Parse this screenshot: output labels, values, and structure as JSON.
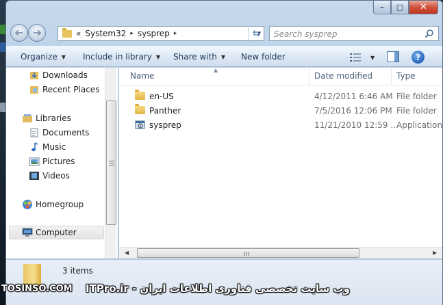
{
  "window": {
    "caption_buttons": {
      "minimize": "–",
      "maximize": "□",
      "close": "✕"
    }
  },
  "nav": {
    "back_icon": "back-arrow-icon",
    "forward_icon": "forward-arrow-icon",
    "address": {
      "prefix": "«",
      "crumbs": [
        "System32",
        "sysprep"
      ],
      "separator": "▸",
      "dropdown": "▾"
    },
    "refresh_glyph": "⇆",
    "search": {
      "placeholder": "Search sysprep",
      "icon": "magnifier-icon"
    }
  },
  "toolbar": {
    "organize": "Organize",
    "include_in_library": "Include in library",
    "share_with": "Share with",
    "new_folder": "New folder",
    "dropdown_arrow": "▼",
    "help": "?"
  },
  "sidebar": {
    "items": [
      {
        "label": "Downloads",
        "icon": "downloads-folder-icon",
        "level": 1
      },
      {
        "label": "Recent Places",
        "icon": "recent-places-icon",
        "level": 1
      },
      {
        "label": "Libraries",
        "icon": "libraries-icon",
        "level": 0
      },
      {
        "label": "Documents",
        "icon": "documents-library-icon",
        "level": 1
      },
      {
        "label": "Music",
        "icon": "music-library-icon",
        "level": 1
      },
      {
        "label": "Pictures",
        "icon": "pictures-library-icon",
        "level": 1
      },
      {
        "label": "Videos",
        "icon": "videos-library-icon",
        "level": 1
      },
      {
        "label": "Homegroup",
        "icon": "homegroup-icon",
        "level": 0
      },
      {
        "label": "Computer",
        "icon": "computer-icon",
        "level": 0,
        "selected": true
      }
    ]
  },
  "file_list": {
    "columns": [
      "Name",
      "Date modified",
      "Type"
    ],
    "sort_indicator": "▲",
    "rows": [
      {
        "name": "en-US",
        "date": "4/12/2011 6:46 AM",
        "type": "File folder",
        "icon": "folder-icon"
      },
      {
        "name": "Panther",
        "date": "7/5/2016 12:06 PM",
        "type": "File folder",
        "icon": "folder-icon"
      },
      {
        "name": "sysprep",
        "date": "11/21/2010 12:59 ...",
        "type": "Application",
        "icon": "application-icon"
      }
    ],
    "scroll_left": "◀",
    "scroll_right": "▶"
  },
  "details": {
    "count": "3 items",
    "icon": "folder-icon"
  },
  "watermark": {
    "left": "TOSINSO.COM",
    "right": "وب سایت تخصصی فناوری اطلاعات ایران - ITPro.ir"
  },
  "colors": {
    "window_frame": "#b4cbe4",
    "toolbar": "#dfeaf6",
    "folder": "#e3b64a",
    "close": "#c3371f",
    "help": "#2f6fc4"
  }
}
